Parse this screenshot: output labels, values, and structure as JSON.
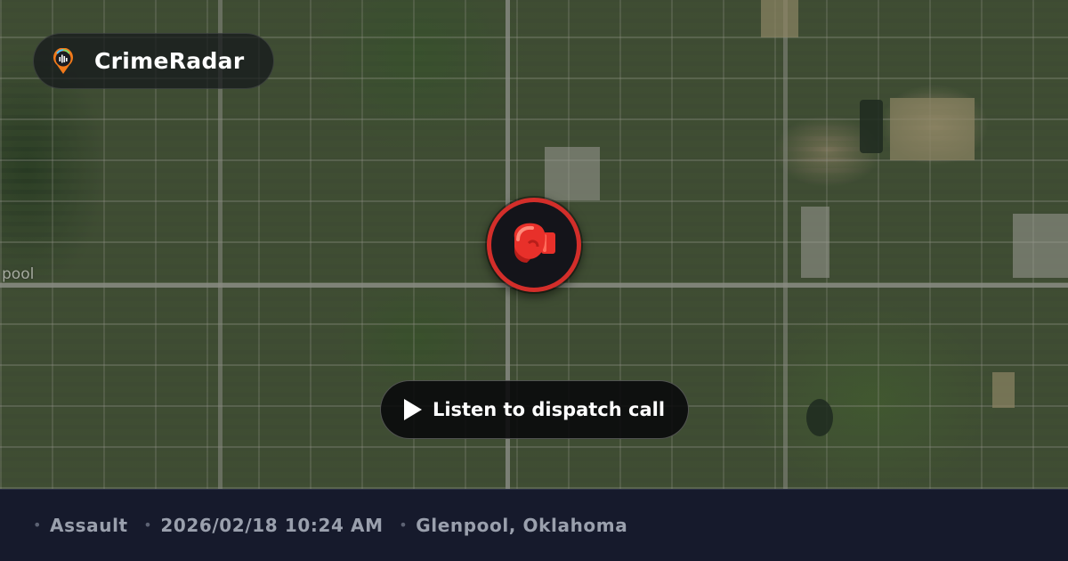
{
  "brand": {
    "name": "CrimeRadar",
    "icon": "radar-pin-logo-icon"
  },
  "map": {
    "place_label_fragment": "pool"
  },
  "marker": {
    "icon": "boxing-glove-icon",
    "ring_color": "#d32e2a"
  },
  "action": {
    "listen_label": "Listen to dispatch call",
    "icon": "play-icon"
  },
  "incident": {
    "type": "Assault",
    "datetime": "2026/02/18 10:24 AM",
    "location": "Glenpool, Oklahoma"
  },
  "colors": {
    "footer_bg": "#161a2c",
    "footer_text": "#9aa0ad",
    "accent": "#d32e2a"
  }
}
